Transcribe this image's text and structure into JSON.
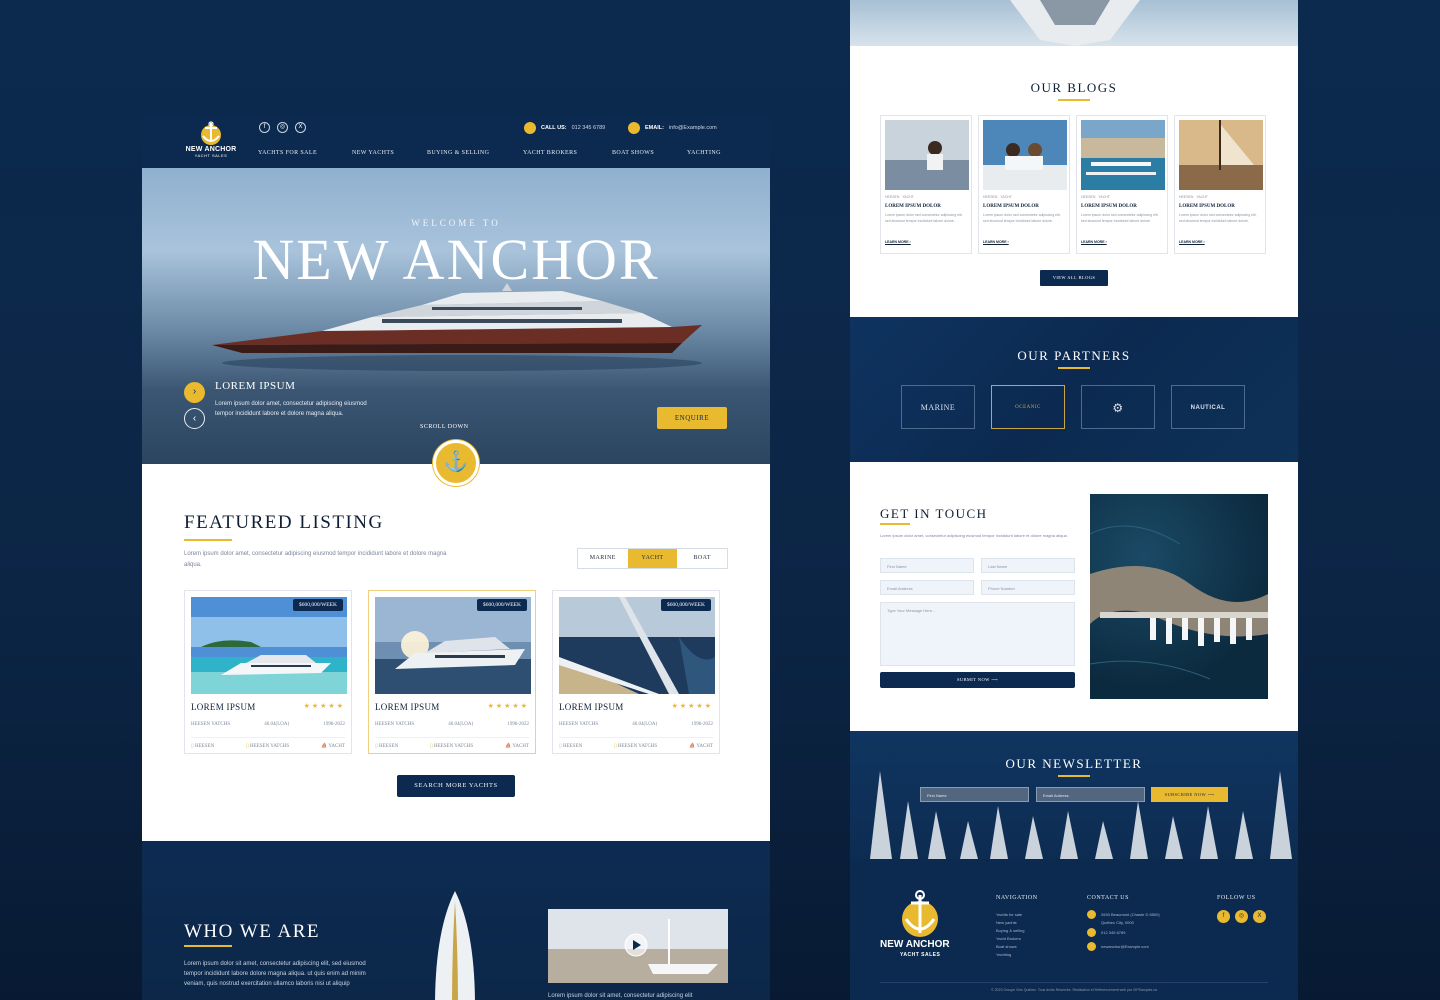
{
  "left": {
    "logo": {
      "name": "NEW ANCHOR",
      "tag": "YACHT SALES"
    },
    "social": [
      "f",
      "◎",
      "X"
    ],
    "contact": {
      "call_label": "CALL US:",
      "call_value": "012 345 6789",
      "email_label": "EMAIL:",
      "email_value": "info@Example.com"
    },
    "nav": [
      "YACHTS FOR SALE",
      "NEW YACHTS",
      "BUYING & SELLING",
      "YACHT BROKERS",
      "BOAT SHOWS",
      "YACHTING"
    ],
    "hero": {
      "welcome": "WELCOME TO",
      "title": "NEW ANCHOR",
      "slide_title": "LOREM IPSUM",
      "slide_text": "Lorem ipsum dolor amet, consectetur adipiscing eiusmod tempor incididunt labore et dolore magna aliqua.",
      "enquire": "ENQUIRE",
      "scroll": "SCROLL DOWN",
      "next": "›",
      "prev": "‹",
      "anchor": "⚓"
    },
    "featured": {
      "title": "FEATURED LISTING",
      "desc": "Lorem ipsum dolor amet, consectetur adipiscing eiusmod tempor incididunt labore et dolore magna aliqua.",
      "tabs": [
        "MARINE",
        "YACHT",
        "BOAT"
      ],
      "cards": [
        {
          "price": "$600,000/WEEK",
          "name": "LOREM IPSUM",
          "stars": "★★★★★",
          "maker": "HEESEN YATCHS",
          "size": "46.04(LOA)",
          "year": "1998-2022",
          "f1": "HEESEN",
          "f2": "HEESEN YATCHS",
          "f3": "YACHT"
        },
        {
          "price": "$600,000/WEEK",
          "name": "LOREM IPSUM",
          "stars": "★★★★★",
          "maker": "HEESEN YATCHS",
          "size": "46.04(LOA)",
          "year": "1998-2022",
          "f1": "HEESEN",
          "f2": "HEESEN YATCHS",
          "f3": "YACHT"
        },
        {
          "price": "$600,000/WEEK",
          "name": "LOREM IPSUM",
          "stars": "★★★★★",
          "maker": "HEESEN YATCHS",
          "size": "46.04(LOA)",
          "year": "1998-2022",
          "f1": "HEESEN",
          "f2": "HEESEN YATCHS",
          "f3": "YACHT"
        }
      ],
      "search_more": "SEARCH MORE YACHTS"
    },
    "who": {
      "title": "WHO WE ARE",
      "text": "Lorem ipsum dolor sit amet, consectetur adipiscing elit, sed eiusmod tempor incididunt labore dolore magna aliqua. ut quis enim ad minim veniam, quis nostrud exercitation ullamco laboris nisi ut aliquip",
      "caption": "Lorem ipsum dolor sit amet, consectetur adipiscing elit"
    }
  },
  "right": {
    "blogs": {
      "title": "OUR BLOGS",
      "items": [
        {
          "meta1": "HEESEN",
          "meta2": "YACHT",
          "title": "LOREM IPSUM DOLOR",
          "text": "Lorem ipsum dolor sed consectetur adipiscing elit, sed eiusmod tempor incididunt labore dolore.",
          "more": "LEARN MORE ›"
        },
        {
          "meta1": "HEESEN",
          "meta2": "YACHT",
          "title": "LOREM IPSUM DOLOR",
          "text": "Lorem ipsum dolor sed consectetur adipiscing elit, sed eiusmod tempor incididunt labore dolore.",
          "more": "LEARN MORE ›"
        },
        {
          "meta1": "HEESEN",
          "meta2": "YACHT",
          "title": "LOREM IPSUM DOLOR",
          "text": "Lorem ipsum dolor sed consectetur adipiscing elit, sed eiusmod tempor incididunt labore dolore.",
          "more": "LEARN MORE ›"
        },
        {
          "meta1": "HEESEN",
          "meta2": "YACHT",
          "title": "LOREM IPSUM DOLOR",
          "text": "Lorem ipsum dolor sed consectetur adipiscing elit, sed eiusmod tempor incididunt labore dolore.",
          "more": "LEARN MORE ›"
        }
      ],
      "view_all": "VIEW ALL BLOGS"
    },
    "partners": {
      "title": "OUR PARTNERS",
      "items": [
        "MARINE",
        "OCEANIC",
        "⚙",
        "NAUTICAL"
      ]
    },
    "touch": {
      "title": "GET IN TOUCH",
      "desc": "Lorem ipsum dolor amet, consectetur adipiscing eiusmod tempor incididunt labore et dolore magna aliqua.",
      "first": "First Name",
      "last": "Last Name",
      "email": "Email Address",
      "phone": "Phone Number",
      "message": "Type Your Message Here...",
      "submit": "SUBMIT NOW ⟶"
    },
    "newsletter": {
      "title": "OUR NEWSLETTER",
      "first": "First Name",
      "email": "Email Address",
      "subscribe": "SUBSCRIBE NOW ⟶"
    },
    "footer": {
      "logo_name": "NEW ANCHOR",
      "logo_tag": "YACHT SALES",
      "nav_title": "NAVIGATION",
      "nav": [
        "Yachts for sale",
        "New yachts",
        "Buying & selling",
        "Yacht Brokers",
        "Boat shows",
        "Yachting"
      ],
      "contact_title": "CONTACT US",
      "address": "2693 Beaumont (Chaste D 8500)",
      "address2": "Québec City, 0000",
      "phone": "012 345 6789",
      "email": "newanchor@Example.com",
      "follow_title": "FOLLOW US",
      "copyright": "© 2023 Groupe Vins Québec. Tous droits Réservés. Réalisation et Référencement web par VIPSamples.ca"
    }
  },
  "colors": {
    "navy": "#0c2a50",
    "gold": "#e9b930",
    "bg": "#0b2a4e"
  }
}
